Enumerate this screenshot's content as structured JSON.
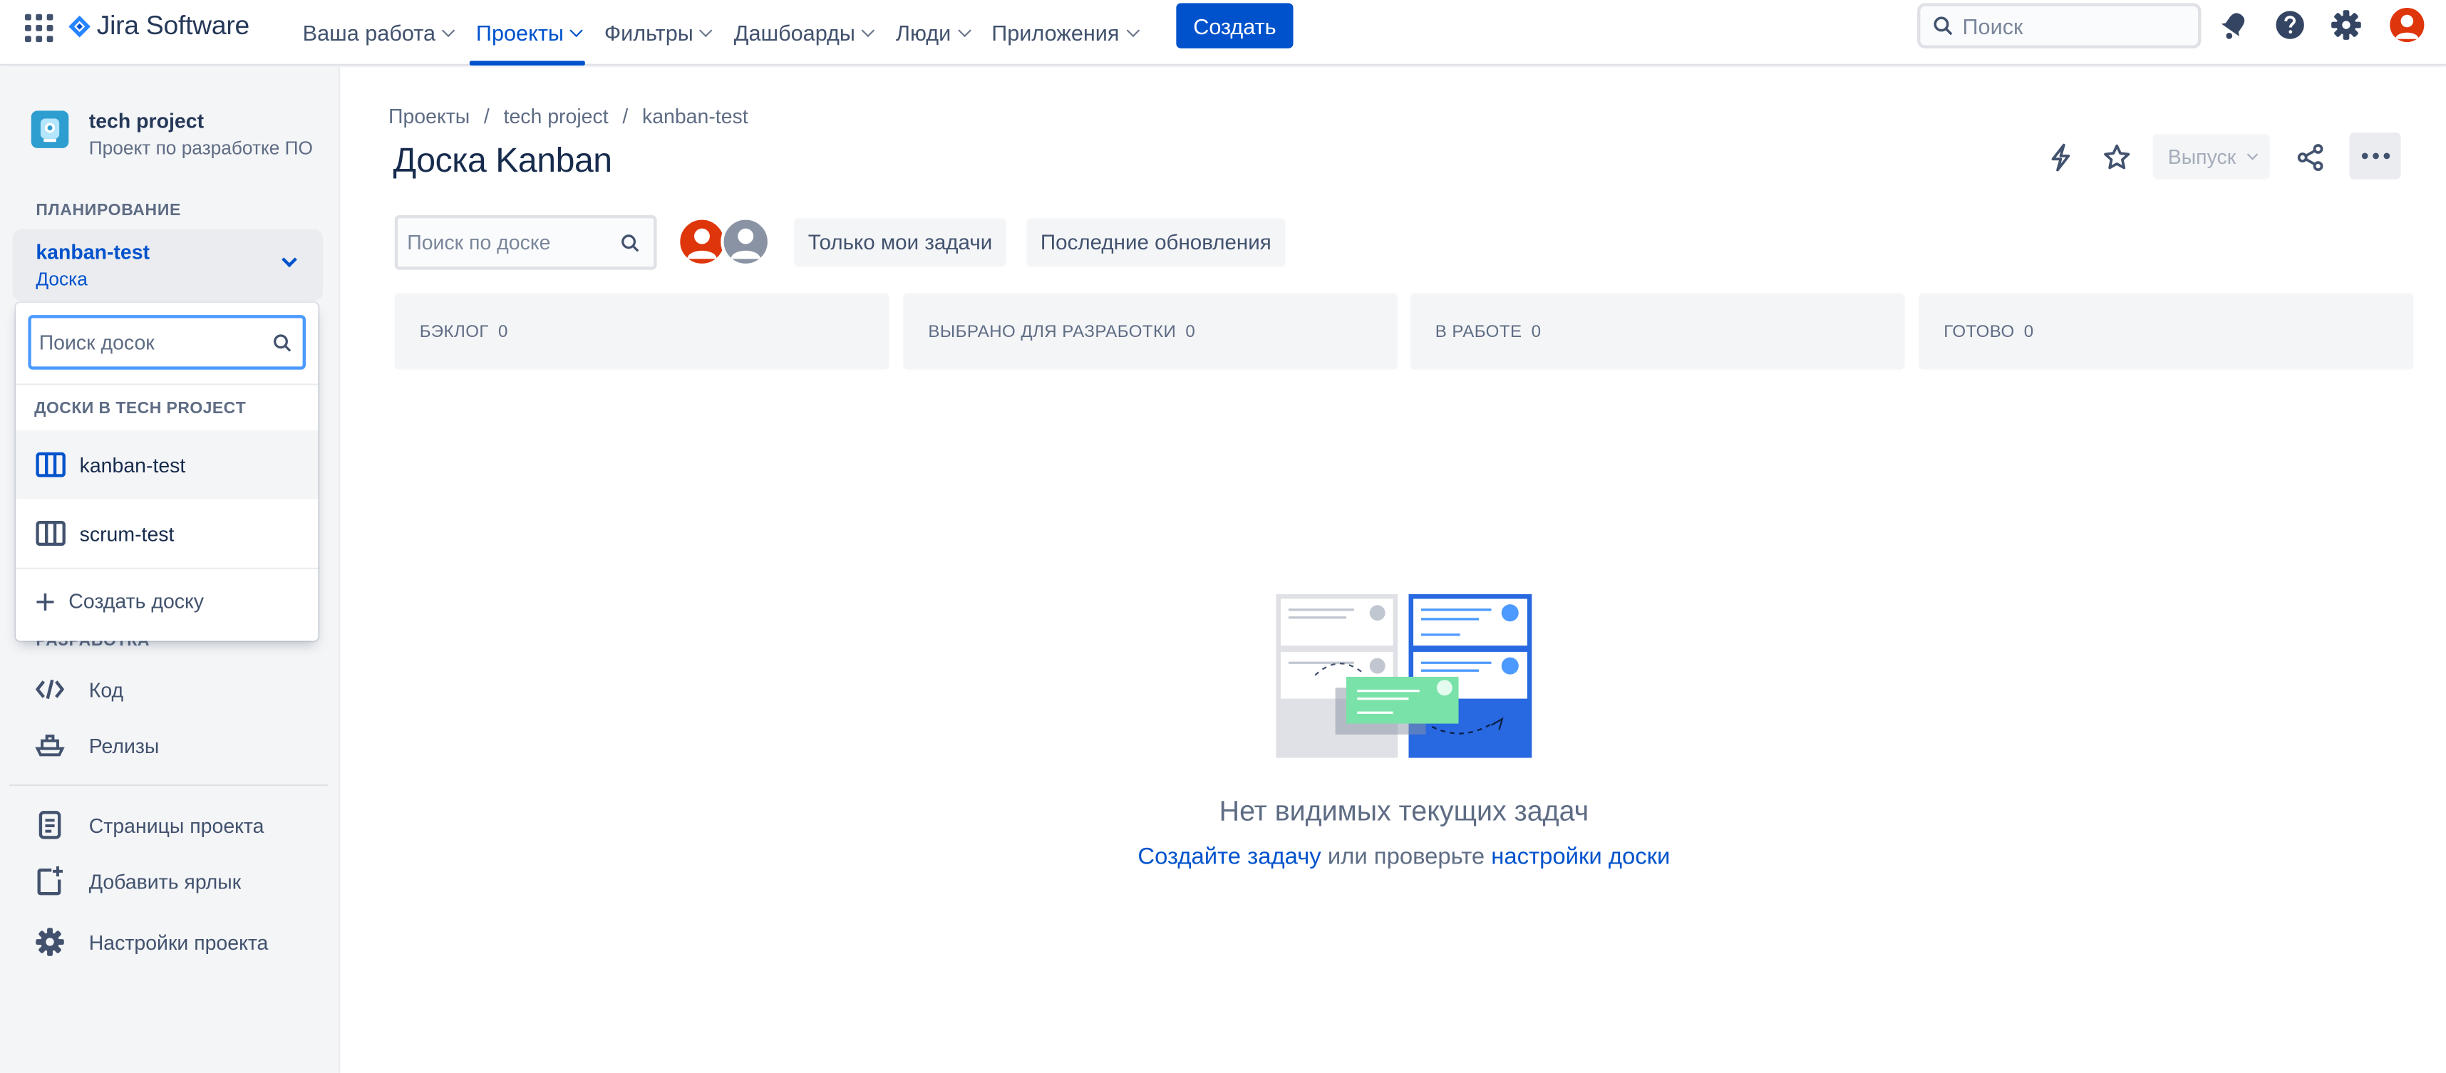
{
  "app": {
    "name": "Jira Software"
  },
  "topnav": {
    "items": [
      {
        "label": "Ваша работа"
      },
      {
        "label": "Проекты"
      },
      {
        "label": "Фильтры"
      },
      {
        "label": "Дашбоарды"
      },
      {
        "label": "Люди"
      },
      {
        "label": "Приложения"
      }
    ],
    "create_label": "Создать",
    "search_placeholder": "Поиск",
    "icons": [
      "notifications-icon",
      "help-icon",
      "settings-icon",
      "user-avatar"
    ]
  },
  "sidebar": {
    "project_name": "tech project",
    "project_type": "Проект по разработке ПО",
    "section_planning": "ПЛАНИРОВАНИЕ",
    "board_name": "kanban-test",
    "board_sub": "Доска",
    "section_dev": "РАЗРАБОТКА",
    "dev_items": [
      {
        "label": "Код",
        "icon": "code-icon"
      },
      {
        "label": "Релизы",
        "icon": "ship-icon"
      }
    ],
    "bottom_items": [
      {
        "label": "Страницы проекта",
        "icon": "page-icon"
      },
      {
        "label": "Добавить ярлык",
        "icon": "add-shortcut-icon"
      },
      {
        "label": "Настройки проекта",
        "icon": "gear-icon"
      }
    ]
  },
  "board_dropdown": {
    "search_placeholder": "Поиск досок",
    "heading": "ДОСКИ В TECH PROJECT",
    "boards": [
      {
        "label": "kanban-test"
      },
      {
        "label": "scrum-test"
      }
    ],
    "create_label": "Создать доску"
  },
  "main": {
    "breadcrumbs": [
      "Проекты",
      "tech project",
      "kanban-test"
    ],
    "title": "Доска Kanban",
    "release_label": "Выпуск",
    "board_search_placeholder": "Поиск по доске",
    "filters": [
      "Только мои задачи",
      "Последние обновления"
    ],
    "columns": [
      {
        "name": "БЭКЛОГ",
        "count": "0"
      },
      {
        "name": "ВЫБРАНО ДЛЯ РАЗРАБОТКИ",
        "count": "0"
      },
      {
        "name": "В РАБОТЕ",
        "count": "0"
      },
      {
        "name": "ГОТОВО",
        "count": "0"
      }
    ],
    "empty": {
      "title": "Нет видимых текущих задач",
      "link1": "Создайте задачу",
      "middle": " или проверьте ",
      "link2": "настройки доски"
    }
  },
  "colors": {
    "accent": "#0052cc",
    "avatar_red": "#de350b",
    "sidebar_bg": "#f4f5f7"
  }
}
